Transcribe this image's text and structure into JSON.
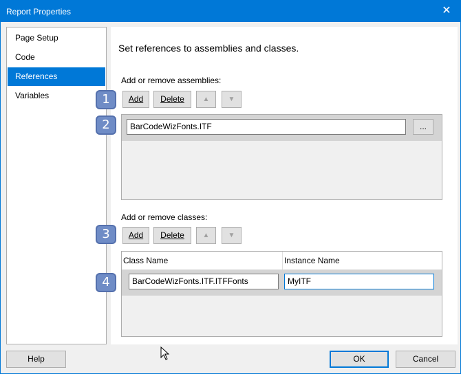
{
  "window": {
    "title": "Report Properties",
    "close_glyph": "✕"
  },
  "nav": {
    "items": [
      {
        "label": "Page Setup",
        "selected": false
      },
      {
        "label": "Code",
        "selected": false
      },
      {
        "label": "References",
        "selected": true
      },
      {
        "label": "Variables",
        "selected": false
      }
    ]
  },
  "main": {
    "heading": "Set references to assemblies and classes.",
    "assemblies": {
      "label": "Add or remove assemblies:",
      "add_label": "Add",
      "delete_label": "Delete",
      "up_icon": "arrow-up-icon",
      "down_icon": "arrow-down-icon",
      "items": [
        "BarCodeWizFonts.ITF"
      ],
      "browse_label": "..."
    },
    "classes": {
      "label": "Add or remove classes:",
      "add_label": "Add",
      "delete_label": "Delete",
      "columns": [
        "Class Name",
        "Instance Name"
      ],
      "rows": [
        {
          "class_name": "BarCodeWizFonts.ITF.ITFFonts",
          "instance_name": "MyITF"
        }
      ]
    }
  },
  "badges": [
    "1",
    "2",
    "3",
    "4"
  ],
  "colors": {
    "accent": "#0078d7",
    "badge": "#6f8cc6"
  },
  "footer": {
    "help_label": "Help",
    "ok_label": "OK",
    "cancel_label": "Cancel"
  }
}
